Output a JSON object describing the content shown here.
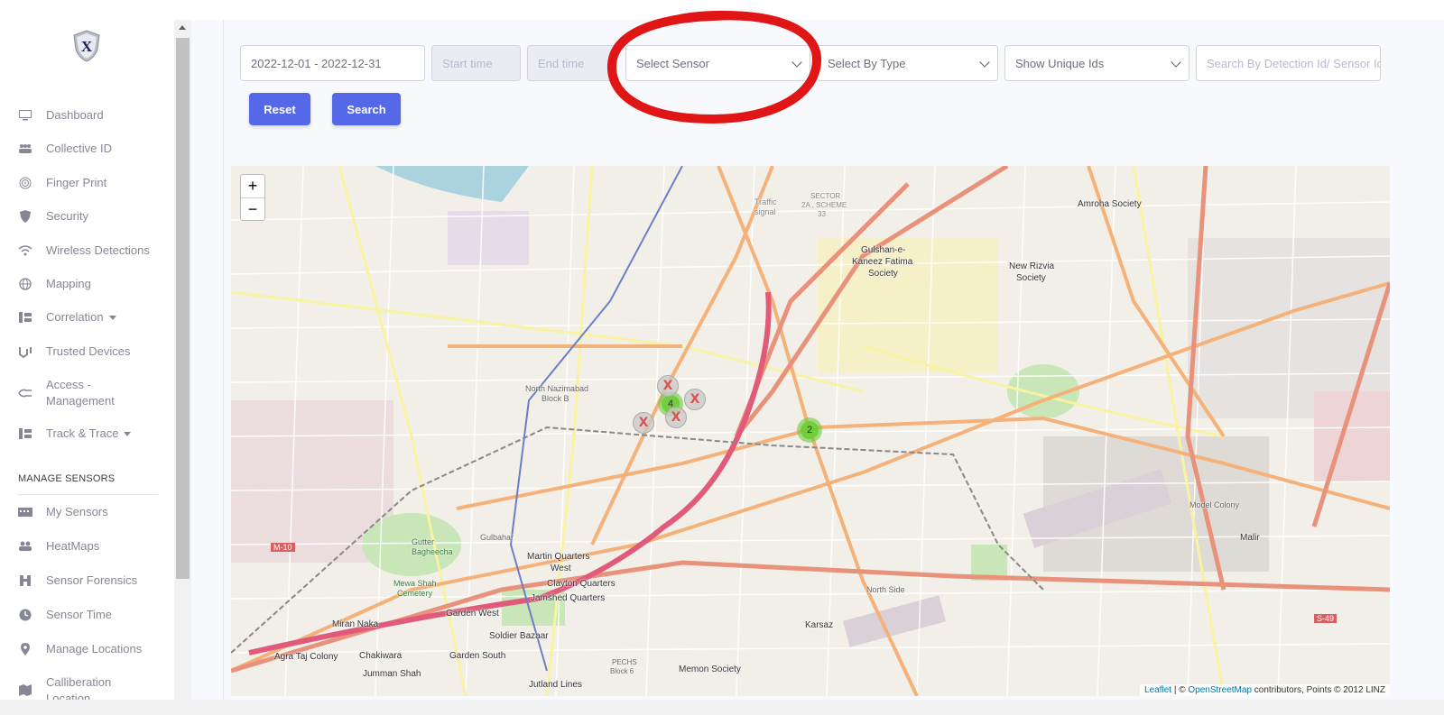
{
  "sidebar": {
    "logo_letter": "X",
    "items": [
      {
        "label": "Dashboard",
        "icon": "monitor-icon"
      },
      {
        "label": "Collective ID",
        "icon": "users-icon"
      },
      {
        "label": "Finger Print",
        "icon": "fingerprint-icon"
      },
      {
        "label": "Security",
        "icon": "shield-icon"
      },
      {
        "label": "Wireless Detections",
        "icon": "wifi-icon"
      },
      {
        "label": "Mapping",
        "icon": "globe-icon"
      },
      {
        "label": "Correlation",
        "icon": "network-icon"
      },
      {
        "label": "Trusted Devices",
        "icon": "handshake-icon"
      },
      {
        "label": "Access - Management",
        "icon": "access-icon"
      },
      {
        "label": "Track & Trace",
        "icon": "network-icon"
      },
      {
        "label": "My Sensors",
        "icon": "sensor-icon"
      },
      {
        "label": "HeatMaps",
        "icon": "users-icon"
      },
      {
        "label": "Sensor Forensics",
        "icon": "binoculars-icon"
      },
      {
        "label": "Sensor Time",
        "icon": "clock-icon"
      },
      {
        "label": "Manage Locations",
        "icon": "map-pin-icon"
      },
      {
        "label": "Calliberation Location",
        "icon": "map-icon"
      }
    ],
    "section_title": "MANAGE SENSORS"
  },
  "filters": {
    "date_range": "2022-12-01 - 2022-12-31",
    "start_time_placeholder": "Start time",
    "end_time_placeholder": "End time",
    "sensor_select": "Select Sensor",
    "type_select": "Select By Type",
    "unique_ids_select": "Show Unique Ids",
    "search_placeholder": "Search By Detection Id/ Sensor Id"
  },
  "buttons": {
    "reset": "Reset",
    "search": "Search"
  },
  "map": {
    "zoom_in": "+",
    "zoom_out": "−",
    "attribution_leaflet": "Leaflet",
    "attribution_sep": " | © ",
    "attribution_osm": "OpenStreetMap",
    "attribution_rest": " contributors, Points © 2012 LINZ",
    "clusters": [
      {
        "count": "2"
      },
      {
        "count": "4"
      }
    ],
    "marker_symbol": "X",
    "labels": {
      "amroha": "Amroha Society",
      "gulshan_kaneez": "Gulshan-e-",
      "gulshan_kaneez2": "Kaneez Fatima",
      "gulshan_kaneez3": "Society",
      "new_rizvia": "New Rizvia",
      "new_rizvia2": "Society",
      "martin": "Martin Quarters",
      "martin2": "West",
      "clayton": "Clayton Quarters",
      "jamshed": "Jamshed Quarters",
      "garden_west": "Garden West",
      "soldier": "Soldier Bazaar",
      "garden_south": "Garden South",
      "miran": "Miran Naka",
      "agra": "Agra Taj Colony",
      "chakiwara": "Chakiwara",
      "jumman": "Jumman Shah",
      "jutland": "Jutland Lines",
      "memon": "Memon Society",
      "karsaz": "Karsaz",
      "north_nazimabad": "North Nazimabad",
      "north_nazimabad2": "Block B",
      "gutter": "Gutter",
      "gutter2": "Bagheecha",
      "mewa": "Mewa Shah",
      "mewa2": "Cemetery",
      "gulbahar": "Gulbahar",
      "model_colony": "Model Colony",
      "malir": "Malir",
      "north_side": "North Side",
      "sector": "SECTOR",
      "sector2": "2A , SCHEME",
      "sector3": "33",
      "traffic": "Traffic",
      "traffic2": "signal",
      "m10": "M-10",
      "s49": "S-49",
      "pechs": "PECHS",
      "pechs2": "Block 6"
    }
  },
  "colors": {
    "primary_button": "#5468e8",
    "annotation": "#e01515",
    "cluster": "#6ecc39",
    "marker_x": "#d9534f"
  }
}
